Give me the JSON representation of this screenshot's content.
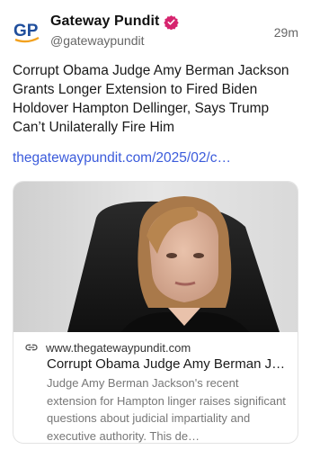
{
  "post": {
    "display_name": "Gateway Pundit",
    "handle": "@gatewaypundit",
    "timestamp": "29m",
    "avatar_text": "GP",
    "text": "Corrupt Obama Judge Amy Berman Jackson Grants Longer Extension to Fired Biden Holdover Hampton Dellinger, Says Trump Can’t Unilaterally Fire Him",
    "link": "thegatewaypundit.com/2025/02/c…"
  },
  "card": {
    "domain": "www.thegatewaypundit.com",
    "title": "Corrupt Obama Judge Amy Berman J…",
    "description": "Judge Amy Berman Jackson's recent extension for Hampton linger raises significant questions about judicial impartiality and executive authority. This de…"
  },
  "colors": {
    "link": "#3b5bdb",
    "verified": "#d6246e",
    "avatar_blue": "#1f4e9c",
    "avatar_orange": "#f2a11f"
  },
  "icons": {
    "verified": "verified-badge-icon",
    "link": "link-chain-icon"
  }
}
